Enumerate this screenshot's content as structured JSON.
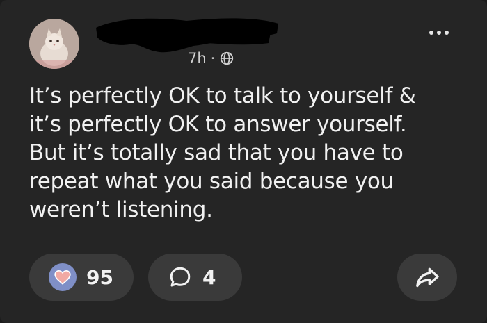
{
  "post": {
    "age": "7h",
    "separator": "·",
    "visibility_icon": "globe-icon",
    "text": "It’s perfectly OK to talk to yourself &\nit’s perfectly OK to answer yourself.\nBut it’s totally sad that you have to\nrepeat what you said because you\nweren’t listening."
  },
  "actions": {
    "likes": "95",
    "replies": "4",
    "like_icon": "heart-icon",
    "reply_icon": "speech-bubble-icon",
    "share_icon": "share-arrow-icon",
    "more_icon": "more-options-icon"
  },
  "colors": {
    "card_bg": "#252525",
    "pill_bg": "#3a3a3a",
    "like_circle": "#7f8fc7",
    "heart_fill": "#f1a9a3"
  }
}
